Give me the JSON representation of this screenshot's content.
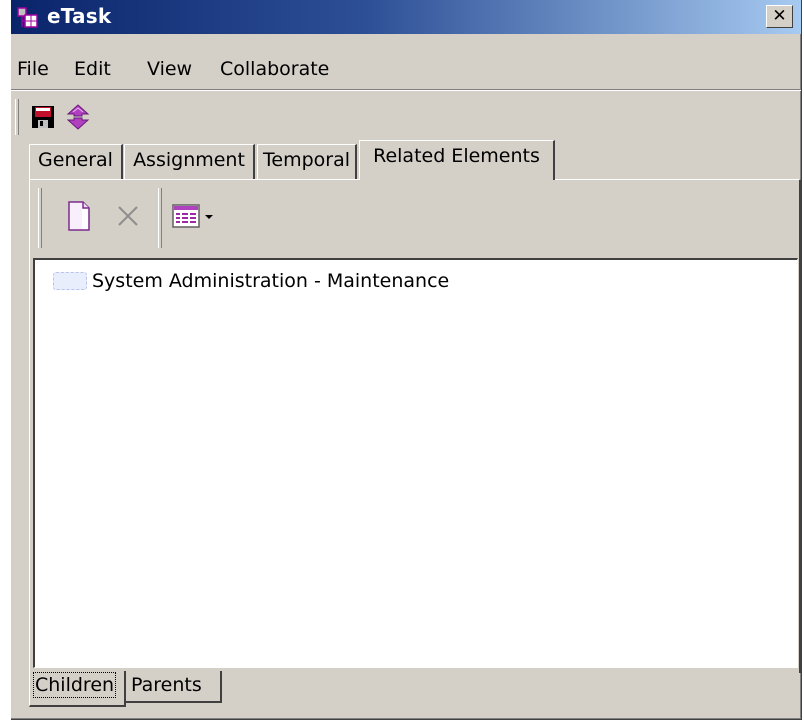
{
  "window": {
    "title": "eTask",
    "close_glyph": "✕",
    "colors": {
      "titlebar_start": "#0a246a",
      "titlebar_end": "#a6caf0",
      "chrome": "#d4d0c8"
    }
  },
  "menu": {
    "items": [
      {
        "label": "File"
      },
      {
        "label": "Edit"
      },
      {
        "label": "View"
      },
      {
        "label": "Collaborate"
      }
    ]
  },
  "toolbar": {
    "icons": [
      "save-icon",
      "refresh-icon"
    ]
  },
  "tabs": [
    {
      "label": "General",
      "active": false
    },
    {
      "label": "Assignment",
      "active": false
    },
    {
      "label": "Temporal",
      "active": false
    },
    {
      "label": "Related Elements",
      "active": true
    }
  ],
  "related": {
    "toolbar_icons": [
      "new-document-icon",
      "delete-icon",
      "table-view-icon",
      "dropdown-arrow-icon"
    ],
    "items": [
      {
        "label": "System Administration - Maintenance"
      }
    ]
  },
  "bottom_tabs": [
    {
      "label": "Children",
      "active": true
    },
    {
      "label": "Parents",
      "active": false
    }
  ]
}
